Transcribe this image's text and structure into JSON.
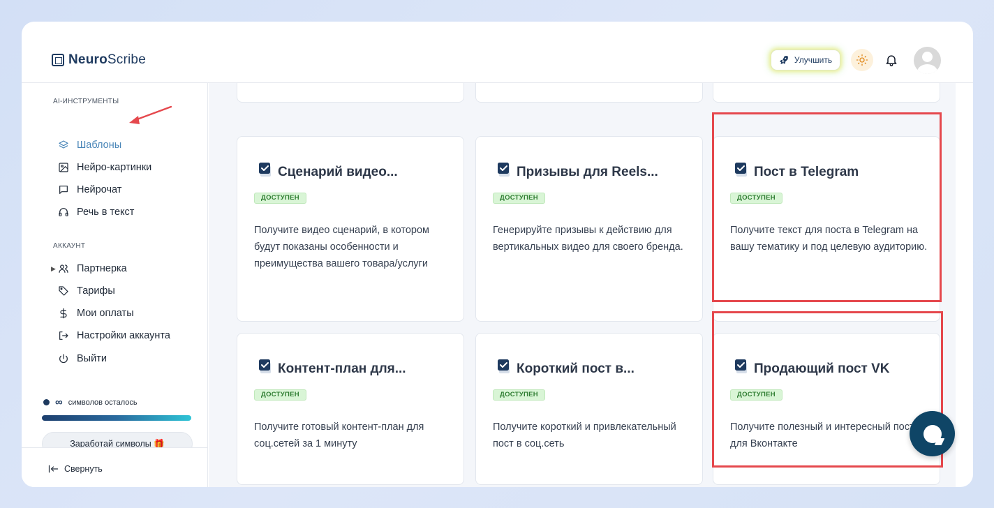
{
  "header": {
    "logo_bold": "Neuro",
    "logo_light": "Scribe",
    "upgrade_label": "Улучшить"
  },
  "sidebar": {
    "section_ai": "AI-ИНСТРУМЕНТЫ",
    "ai_items": [
      {
        "label": "Шаблоны",
        "icon": "layers-icon",
        "active": true
      },
      {
        "label": "Нейро-картинки",
        "icon": "image-icon"
      },
      {
        "label": "Нейрочат",
        "icon": "chat-icon"
      },
      {
        "label": "Речь в текст",
        "icon": "headphones-icon"
      }
    ],
    "section_account": "АККАУНТ",
    "account_items": [
      {
        "label": "Партнерка",
        "icon": "users-icon"
      },
      {
        "label": "Тарифы",
        "icon": "tag-icon"
      },
      {
        "label": "Мои оплаты",
        "icon": "dollar-icon"
      },
      {
        "label": "Настройки аккаунта",
        "icon": "logout-arrow-icon"
      },
      {
        "label": "Выйти",
        "icon": "power-icon"
      }
    ],
    "symbols_value": "∞",
    "symbols_text": "символов осталось",
    "symbols_progress": 1.0,
    "earn_label": "Заработай символы 🎁",
    "collapse_label": "Свернуть"
  },
  "cards": [
    {
      "title": "Сценарий видео...",
      "badge": "ДОСТУПЕН",
      "desc": "Получите видео сценарий, в котором будут показаны особенности и преимущества вашего товара/услуги"
    },
    {
      "title": "Призывы для Reels...",
      "badge": "ДОСТУПЕН",
      "desc": "Генерируйте призывы к действию для вертикальных видео для своего бренда."
    },
    {
      "title": "Пост в Telegram",
      "badge": "ДОСТУПЕН",
      "desc": "Получите текст для поста в Telegram на вашу тематику и под целевую аудиторию."
    },
    {
      "title": "Контент-план для...",
      "badge": "ДОСТУПЕН",
      "desc": "Получите готовый контент-план для соц.сетей за 1 минуту"
    },
    {
      "title": "Короткий пост в...",
      "badge": "ДОСТУПЕН",
      "desc": "Получите короткий и привлекательный пост в соц.сеть"
    },
    {
      "title": "Продающий пост VK",
      "badge": "ДОСТУПЕН",
      "desc": "Получите полезный и интересный пост для Вконтакте"
    }
  ],
  "colors": {
    "accent": "#1e3a5f",
    "active_nav": "#4a86b8",
    "highlight": "#e5484d",
    "badge_bg": "#d9f5d6",
    "chat_button": "#0f4566"
  }
}
